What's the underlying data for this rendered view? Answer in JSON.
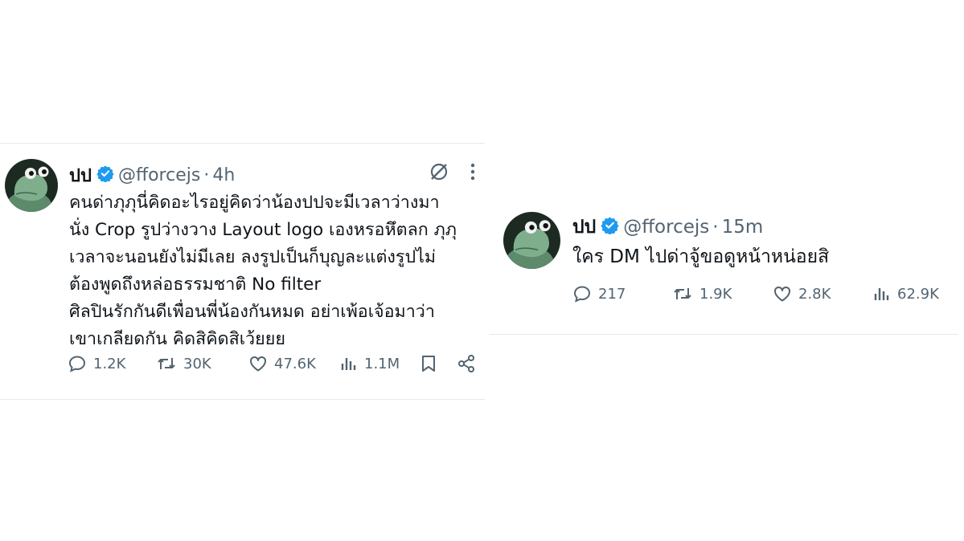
{
  "tweets": [
    {
      "name": "ปป",
      "handle": "@fforcejs",
      "time": "4h",
      "text_lines": [
        "คนด่าภุภุนี่คิดอะไรอยู่คิดว่าน้องปปจะมีเวลาว่างมา",
        "นั่ง Crop รูปว่างวาง Layout logo เองหรอหึตลก ภุภุ",
        "เวลาจะนอนยังไม่มีเลย ลงรูปเป็นก็บุญละแต่งรูปไม่",
        "ต้องพูดถึงหล่อธรรมชาติ No filter",
        "ศิลปินรักกันดีเพื่อนพี่น้องกันหมด อย่าเพ้อเจ้อมาว่า",
        "เขาเกลียดกัน คิดสิคิดสิเว้ยยย"
      ],
      "replies": "1.2K",
      "reposts": "30K",
      "likes": "47.6K",
      "views": "1.1M"
    },
    {
      "name": "ปป",
      "handle": "@fforcejs",
      "time": "15m",
      "text_lines": [
        "ใคร DM ไปด่าจู้ขอดูหน้าหน่อยสิ"
      ],
      "replies": "217",
      "reposts": "1.9K",
      "likes": "2.8K",
      "views": "62.9K"
    }
  ],
  "separator": "·",
  "icons": {
    "verified": "verified-badge-icon",
    "grok": "grok-icon",
    "more": "more-dots-icon",
    "reply": "reply-icon",
    "repost": "repost-icon",
    "like": "like-icon",
    "views": "views-icon",
    "bookmark": "bookmark-icon",
    "share": "share-icon"
  },
  "colors": {
    "verified": "#1d9bf0",
    "text": "#0f1419",
    "secondary": "#536471"
  }
}
